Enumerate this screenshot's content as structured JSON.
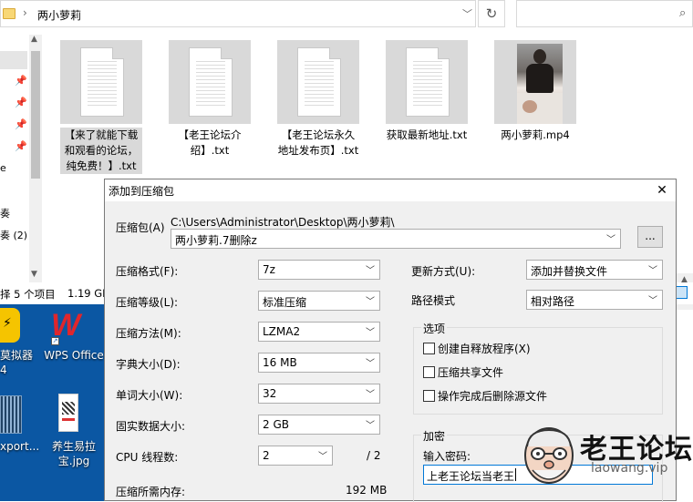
{
  "explorer": {
    "breadcrumb": "两小萝莉",
    "breadcrumb_sep": "›",
    "refresh_glyph": "↻",
    "search_glyph": "⌕",
    "files": [
      {
        "name": "【来了就能下载和观看的论坛，纯免费！】.txt",
        "type": "txt",
        "selected": true
      },
      {
        "name": "【老王论坛介绍】.txt",
        "type": "txt"
      },
      {
        "name": "【老王论坛永久地址发布页】.txt",
        "type": "txt"
      },
      {
        "name": "获取最新地址.txt",
        "type": "txt"
      },
      {
        "name": "两小萝莉.mp4",
        "type": "video"
      }
    ],
    "nav_fragments": [
      "e",
      "奏",
      "奏 (2)"
    ],
    "status": {
      "items": "择 5 个项目",
      "size": "1.19 GB"
    }
  },
  "desktop": {
    "icons": [
      {
        "label": "莫拟器4"
      },
      {
        "label": "WPS Office"
      },
      {
        "label": "xport..."
      },
      {
        "label": "养生易拉宝.jpg"
      }
    ]
  },
  "dialog": {
    "title": "添加到压缩包",
    "close_glyph": "✕",
    "archive": {
      "label": "压缩包(A)",
      "path": "C:\\Users\\Administrator\\Desktop\\两小萝莉\\",
      "name": "两小萝莉.7删除z",
      "browse_label": "..."
    },
    "left_fields": [
      {
        "label": "压缩格式(F):",
        "value": "7z",
        "enabled": true
      },
      {
        "label": "压缩等级(L):",
        "value": "标准压缩",
        "enabled": true
      },
      {
        "label": "压缩方法(M):",
        "value": "LZMA2",
        "enabled": true
      },
      {
        "label": "字典大小(D):",
        "value": "16 MB",
        "enabled": true
      },
      {
        "label": "单词大小(W):",
        "value": "32",
        "enabled": true
      },
      {
        "label": "固实数据大小:",
        "value": "2 GB",
        "enabled": true
      }
    ],
    "cpu": {
      "label": "CPU 线程数:",
      "value": "2",
      "max": "/ 2"
    },
    "memory": {
      "label": "压缩所需内存:",
      "value": "192 MB"
    },
    "update_mode": {
      "label": "更新方式(U):",
      "value": "添加并替换文件"
    },
    "path_mode": {
      "label": "路径模式",
      "value": "相对路径"
    },
    "options": {
      "title": "选项",
      "items": [
        {
          "label": "创建自释放程序(X)",
          "checked": false
        },
        {
          "label": "压缩共享文件",
          "checked": false
        },
        {
          "label": "操作完成后删除源文件",
          "checked": false
        }
      ]
    },
    "encryption": {
      "title": "加密",
      "password_label": "输入密码:",
      "password_value": "上老王论坛当老王"
    }
  },
  "watermark": {
    "text": "老王论坛",
    "url": "laowang.vip"
  }
}
